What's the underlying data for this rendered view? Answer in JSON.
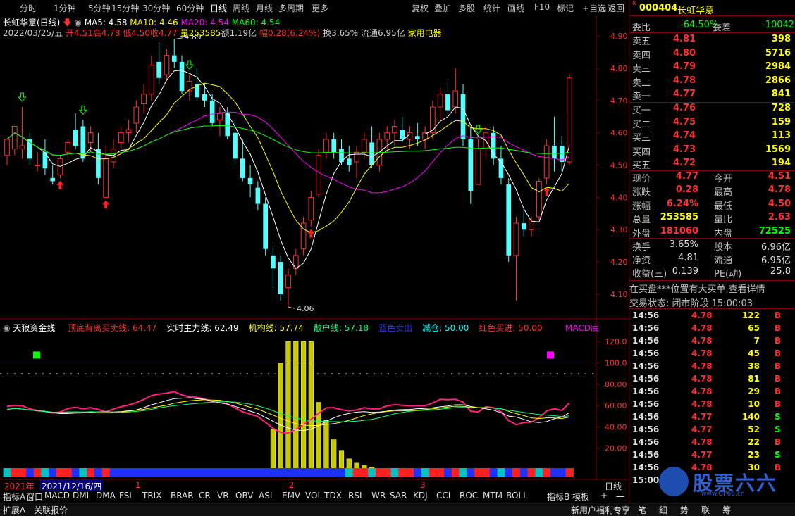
{
  "toolbar": {
    "periods": [
      "分时",
      "1分钟",
      "5分钟",
      "15分钟",
      "30分钟",
      "60分钟",
      "日线",
      "周线",
      "月线",
      "多周期",
      "更多"
    ],
    "active_period": "日线",
    "actions": [
      "复权",
      "叠加",
      "多股",
      "统计",
      "画线",
      "F10",
      "标记",
      "+自选",
      "返回"
    ]
  },
  "chart_header": {
    "stock_name": "长虹华意(日线)",
    "ma5": "MA5: 4.58",
    "ma10": "MA10: 4.46",
    "ma20": "MA20: 4.54",
    "ma60": "MA60: 4.54",
    "date_line": "2022/03/25/五",
    "open": "开4.51",
    "high": "高4.78",
    "low": "低4.50",
    "close": "收4.77",
    "volume": "量253585",
    "amount": "额1.19亿",
    "range": "幅0.28(6.24%)",
    "turnover": "换3.65%",
    "float": "流通6.95亿",
    "industry": "家用电器"
  },
  "chart_data": [
    {
      "type": "candlestick",
      "title": "长虹华意(日线)",
      "ylim": [
        4.06,
        4.89
      ],
      "y_ticks": [
        "4.90",
        "4.80",
        "4.70",
        "4.60",
        "4.50",
        "4.40",
        "4.30",
        "4.20",
        "4.10"
      ],
      "annotations": [
        "4.89",
        "4.06"
      ],
      "candles": [
        [
          4.53,
          4.58,
          4.5,
          4.58
        ],
        [
          4.55,
          4.62,
          4.53,
          4.62
        ],
        [
          4.55,
          4.68,
          4.52,
          4.56
        ],
        [
          4.58,
          4.6,
          4.5,
          4.52
        ],
        [
          4.5,
          4.54,
          4.48,
          4.5
        ],
        [
          4.54,
          4.58,
          4.47,
          4.49
        ],
        [
          4.46,
          4.5,
          4.44,
          4.45
        ],
        [
          4.47,
          4.53,
          4.46,
          4.52
        ],
        [
          4.54,
          4.58,
          4.52,
          4.57
        ],
        [
          4.61,
          4.66,
          4.55,
          4.56
        ],
        [
          4.62,
          4.64,
          4.51,
          4.52
        ],
        [
          4.57,
          4.62,
          4.54,
          4.6
        ],
        [
          4.55,
          4.6,
          4.44,
          4.46
        ],
        [
          4.4,
          4.56,
          4.4,
          4.52
        ],
        [
          4.51,
          4.58,
          4.49,
          4.55
        ],
        [
          4.57,
          4.62,
          4.55,
          4.6
        ],
        [
          4.6,
          4.64,
          4.57,
          4.61
        ],
        [
          4.63,
          4.7,
          4.6,
          4.68
        ],
        [
          4.69,
          4.75,
          4.66,
          4.72
        ],
        [
          4.72,
          4.84,
          4.7,
          4.81
        ],
        [
          4.82,
          4.88,
          4.75,
          4.77
        ],
        [
          4.78,
          4.86,
          4.76,
          4.84
        ],
        [
          4.84,
          4.89,
          4.8,
          4.82
        ],
        [
          4.82,
          4.84,
          4.72,
          4.73
        ],
        [
          4.73,
          4.78,
          4.7,
          4.76
        ],
        [
          4.75,
          4.8,
          4.7,
          4.71
        ],
        [
          4.72,
          4.75,
          4.68,
          4.7
        ],
        [
          4.7,
          4.72,
          4.62,
          4.63
        ],
        [
          4.64,
          4.68,
          4.59,
          4.66
        ],
        [
          4.66,
          4.68,
          4.58,
          4.59
        ],
        [
          4.6,
          4.64,
          4.5,
          4.52
        ],
        [
          4.52,
          4.58,
          4.45,
          4.46
        ],
        [
          4.46,
          4.5,
          4.4,
          4.44
        ],
        [
          4.43,
          4.45,
          4.36,
          4.38
        ],
        [
          4.38,
          4.4,
          4.22,
          4.24
        ],
        [
          4.22,
          4.25,
          4.12,
          4.18
        ],
        [
          4.2,
          4.22,
          4.08,
          4.1
        ],
        [
          4.12,
          4.18,
          4.06,
          4.16
        ],
        [
          4.18,
          4.24,
          4.16,
          4.22
        ],
        [
          4.24,
          4.34,
          4.22,
          4.32
        ],
        [
          4.33,
          4.42,
          4.31,
          4.4
        ],
        [
          4.41,
          4.55,
          4.4,
          4.53
        ],
        [
          4.54,
          4.6,
          4.52,
          4.58
        ],
        [
          4.58,
          4.6,
          4.52,
          4.54
        ],
        [
          4.55,
          4.58,
          4.5,
          4.51
        ],
        [
          4.52,
          4.56,
          4.48,
          4.5
        ],
        [
          4.51,
          4.56,
          4.46,
          4.54
        ],
        [
          4.54,
          4.6,
          4.52,
          4.58
        ],
        [
          4.57,
          4.62,
          4.49,
          4.5
        ],
        [
          4.5,
          4.6,
          4.48,
          4.58
        ],
        [
          4.58,
          4.62,
          4.54,
          4.6
        ],
        [
          4.6,
          4.64,
          4.56,
          4.62
        ],
        [
          4.61,
          4.65,
          4.57,
          4.58
        ],
        [
          4.58,
          4.62,
          4.55,
          4.6
        ],
        [
          4.59,
          4.63,
          4.56,
          4.58
        ],
        [
          4.58,
          4.62,
          4.55,
          4.6
        ],
        [
          4.6,
          4.7,
          4.58,
          4.68
        ],
        [
          4.68,
          4.74,
          4.64,
          4.72
        ],
        [
          4.72,
          4.76,
          4.66,
          4.67
        ],
        [
          4.68,
          4.8,
          4.66,
          4.73
        ],
        [
          4.72,
          4.75,
          4.56,
          4.58
        ],
        [
          4.58,
          4.62,
          4.38,
          4.42
        ],
        [
          4.44,
          4.58,
          4.44,
          4.55
        ],
        [
          4.55,
          4.62,
          4.52,
          4.6
        ],
        [
          4.6,
          4.62,
          4.5,
          4.52
        ],
        [
          4.52,
          4.56,
          4.44,
          4.46
        ],
        [
          4.44,
          4.46,
          4.2,
          4.22
        ],
        [
          4.22,
          4.34,
          4.08,
          4.32
        ],
        [
          4.32,
          4.36,
          4.28,
          4.3
        ],
        [
          4.3,
          4.34,
          4.28,
          4.33
        ],
        [
          4.34,
          4.46,
          4.33,
          4.45
        ],
        [
          4.46,
          4.58,
          4.44,
          4.56
        ],
        [
          4.56,
          4.65,
          4.48,
          4.52
        ],
        [
          4.56,
          4.59,
          4.48,
          4.51
        ],
        [
          4.51,
          4.78,
          4.5,
          4.77
        ]
      ],
      "ma_lines": {
        "MA5": "#ffffff",
        "MA10": "#ffff00",
        "MA20": "#ff00ff",
        "MA60": "#00ff00"
      }
    },
    {
      "type": "line",
      "title": "天狼资金线",
      "ylim": [
        0,
        120
      ],
      "y_ticks": [
        "120.0",
        "100.0",
        "80.00",
        "60.00",
        "40.00",
        "20.00"
      ],
      "series_labels": [
        {
          "name": "顶底背离买卖线",
          "value": "64.47",
          "color": "#ff3030"
        },
        {
          "name": "实时主力线",
          "value": "62.49",
          "color": "#ffffff"
        },
        {
          "name": "机构线",
          "value": "57.74",
          "color": "#ffff00"
        },
        {
          "name": "散户线",
          "value": "57.18",
          "color": "#00ff80"
        },
        {
          "name": "蓝色卖出",
          "value": "",
          "color": "#3030ff"
        },
        {
          "name": "减仓",
          "value": "50.00",
          "color": "#00ffff"
        },
        {
          "name": "红色买进",
          "value": "50.00",
          "color": "#ff3030"
        }
      ],
      "bar_values": [
        0,
        0,
        0,
        0,
        0,
        0,
        0,
        0,
        0,
        0,
        0,
        0,
        0,
        0,
        0,
        0,
        0,
        0,
        0,
        0,
        0,
        0,
        0,
        0,
        0,
        0,
        0,
        0,
        0,
        0,
        0,
        0,
        0,
        0,
        0,
        38,
        100,
        120,
        120,
        120,
        120,
        63,
        46,
        28,
        18,
        10,
        6,
        4,
        2,
        1,
        1,
        1,
        1,
        1,
        0,
        0,
        0,
        0,
        0,
        0,
        0,
        0,
        0,
        0,
        0,
        0,
        0,
        0,
        0,
        0,
        0,
        0,
        0,
        0,
        0
      ]
    }
  ],
  "indicator_labels": {
    "macd_tag": "MACD底"
  },
  "axis": {
    "year": "2021年",
    "date_selected": "2021/12/16/四",
    "month_marks": [
      "1",
      "2",
      "3"
    ],
    "period_label": "日线"
  },
  "indicator_tabs": [
    "指标A",
    "窗口",
    "MACD",
    "DMI",
    "DMA",
    "FSL",
    "TRIX",
    "BRAR",
    "CR",
    "VR",
    "OBV",
    "ASI",
    "EMV",
    "VOL-TDX",
    "RSI",
    "WR",
    "SAR",
    "KDJ",
    "CCI",
    "ROC",
    "MTM",
    "BOLL"
  ],
  "indicator_tabs_right": [
    "指标B",
    "模板",
    "+",
    "一"
  ],
  "status_bar": {
    "expand": "扩展Λ",
    "related": "关联报价",
    "promo": "新用户福利专享",
    "fn_keys": [
      "笔",
      "细",
      "势",
      "联",
      "筹"
    ]
  },
  "quote": {
    "code": "000404",
    "name": "长虹华意",
    "weibi_label": "委比",
    "weibi": "-64.50%",
    "weicha_label": "委差",
    "weicha": "-10042",
    "asks": [
      {
        "label": "卖五",
        "price": "4.81",
        "vol": "398"
      },
      {
        "label": "卖四",
        "price": "4.80",
        "vol": "5716"
      },
      {
        "label": "卖三",
        "price": "4.79",
        "vol": "2984"
      },
      {
        "label": "卖二",
        "price": "4.78",
        "vol": "2866"
      },
      {
        "label": "卖一",
        "price": "4.77",
        "vol": "841"
      }
    ],
    "bids": [
      {
        "label": "买一",
        "price": "4.76",
        "vol": "728"
      },
      {
        "label": "买二",
        "price": "4.75",
        "vol": "159"
      },
      {
        "label": "买三",
        "price": "4.74",
        "vol": "113"
      },
      {
        "label": "买四",
        "price": "4.73",
        "vol": "1569"
      },
      {
        "label": "买五",
        "price": "4.72",
        "vol": "194"
      }
    ],
    "stats": [
      {
        "l1": "现价",
        "v1": "4.77",
        "c1": "#ff3030",
        "l2": "今开",
        "v2": "4.51",
        "c2": "#ff3030"
      },
      {
        "l1": "涨跌",
        "v1": "0.28",
        "c1": "#ff3030",
        "l2": "最高",
        "v2": "4.78",
        "c2": "#ff3030"
      },
      {
        "l1": "涨幅",
        "v1": "6.24%",
        "c1": "#ff3030",
        "l2": "最低",
        "v2": "4.50",
        "c2": "#ff3030"
      },
      {
        "l1": "总量",
        "v1": "253585",
        "c1": "#ffff00",
        "l2": "量比",
        "v2": "2.63",
        "c2": "#ff3030"
      },
      {
        "l1": "外盘",
        "v1": "181060",
        "c1": "#ff3030",
        "l2": "内盘",
        "v2": "72525",
        "c2": "#00ff00"
      }
    ],
    "fin": [
      {
        "l1": "换手",
        "v1": "3.65%",
        "l2": "股本",
        "v2": "6.96亿"
      },
      {
        "l1": "净资",
        "v1": "4.81",
        "l2": "流通",
        "v2": "6.95亿"
      },
      {
        "l1": "收益(三)",
        "v1": "0.139",
        "l2": "PE(动)",
        "v2": "25.8"
      }
    ],
    "notice": "在买盘***位置有大买单,查看详情",
    "trade_state": "交易状态: 闭市阶段 15:00:03",
    "ticks": [
      {
        "t": "14:56",
        "p": "4.78",
        "v": "122",
        "s": "B"
      },
      {
        "t": "14:56",
        "p": "4.78",
        "v": "65",
        "s": "B"
      },
      {
        "t": "14:56",
        "p": "4.78",
        "v": "7",
        "s": "B"
      },
      {
        "t": "14:56",
        "p": "4.78",
        "v": "45",
        "s": "B"
      },
      {
        "t": "14:56",
        "p": "4.78",
        "v": "38",
        "s": "B"
      },
      {
        "t": "14:56",
        "p": "4.78",
        "v": "81",
        "s": "B"
      },
      {
        "t": "14:56",
        "p": "4.78",
        "v": "29",
        "s": "B"
      },
      {
        "t": "14:56",
        "p": "4.78",
        "v": "10",
        "s": "B"
      },
      {
        "t": "14:56",
        "p": "4.77",
        "v": "140",
        "s": "S"
      },
      {
        "t": "14:56",
        "p": "4.77",
        "v": "52",
        "s": "S"
      },
      {
        "t": "14:56",
        "p": "4.78",
        "v": "22",
        "s": "B"
      },
      {
        "t": "14:56",
        "p": "4.77",
        "v": "23",
        "s": "S"
      },
      {
        "t": "14:56",
        "p": "4.78",
        "v": "30",
        "s": "B"
      },
      {
        "t": "15:00",
        "p": "",
        "v": "",
        "s": ""
      }
    ]
  },
  "watermark": {
    "text": "股票六六",
    "url": "www.GP66.cn"
  },
  "colors": {
    "up": "#ff3030",
    "down": "#54ffff",
    "bg": "#000000",
    "grid": "#800000"
  }
}
